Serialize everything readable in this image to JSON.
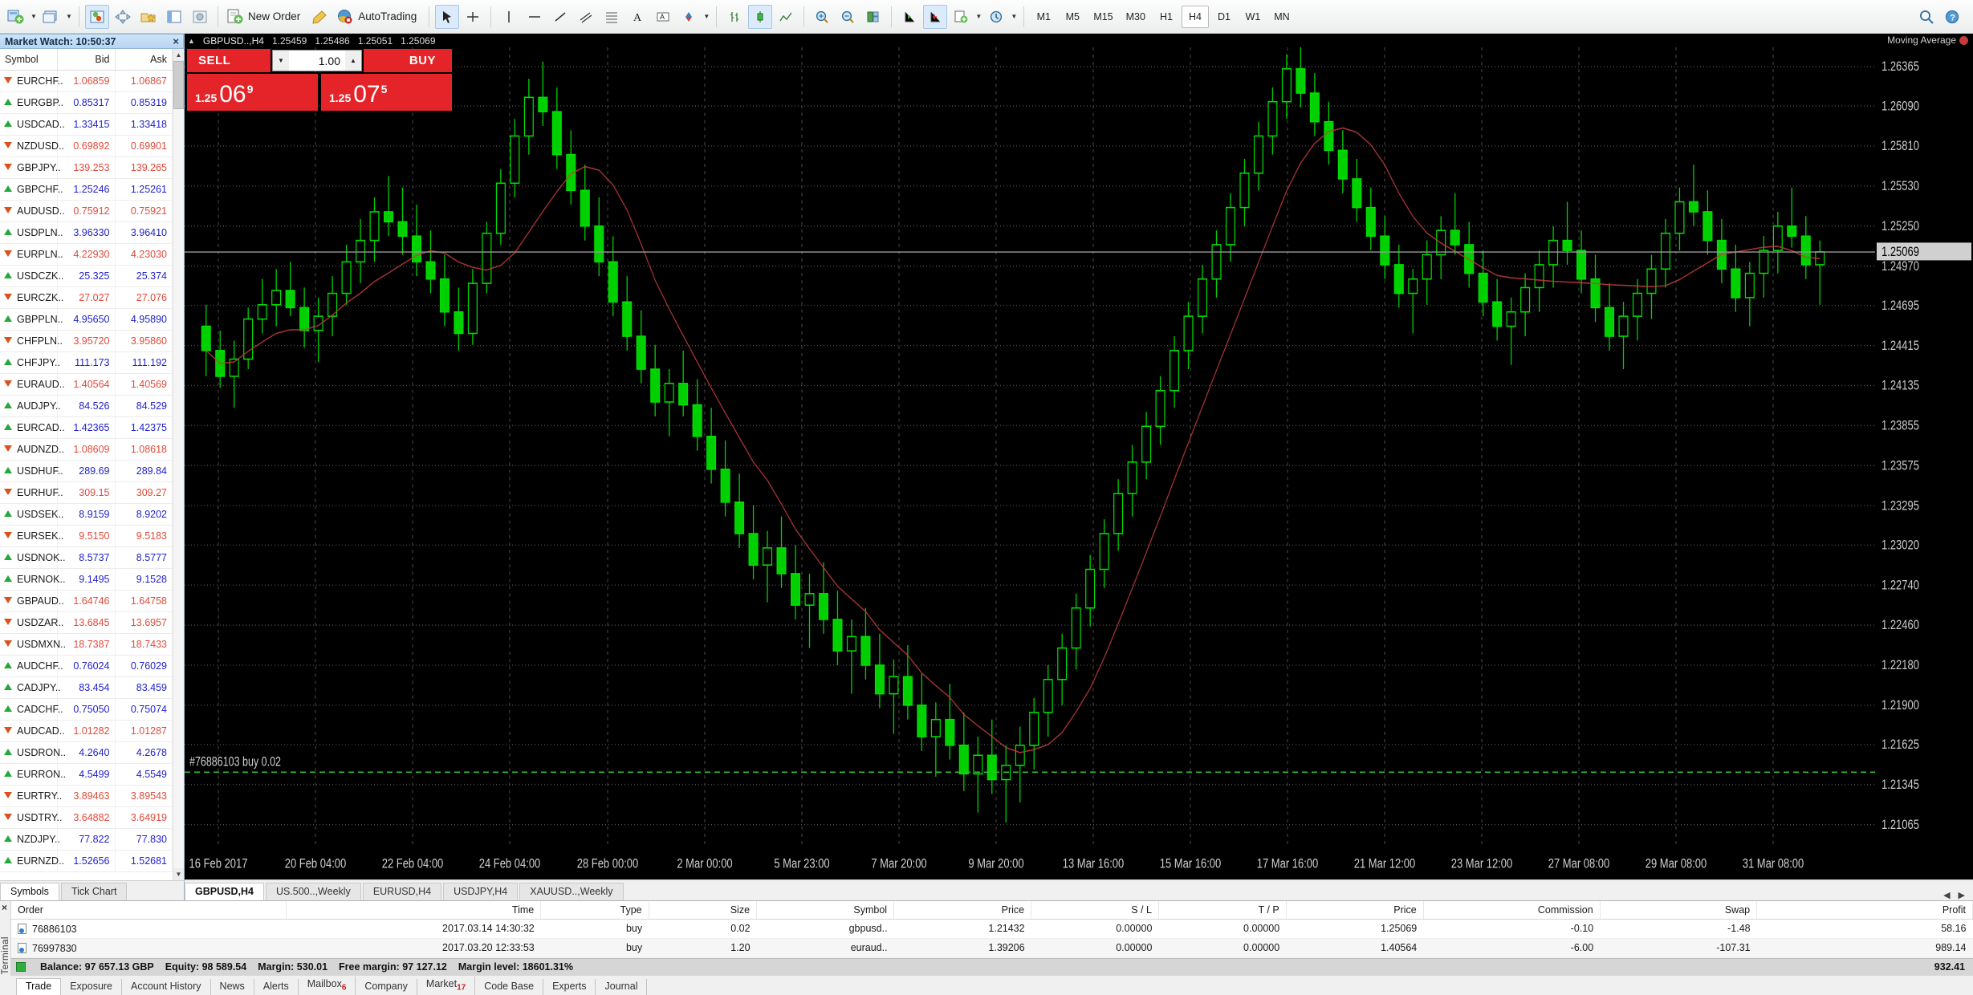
{
  "toolbar": {
    "new_order_label": "New Order",
    "autotrading_label": "AutoTrading",
    "timeframes": [
      {
        "label": "M1",
        "active": false
      },
      {
        "label": "M5",
        "active": false
      },
      {
        "label": "M15",
        "active": false
      },
      {
        "label": "M30",
        "active": false
      },
      {
        "label": "H1",
        "active": false
      },
      {
        "label": "H4",
        "active": true
      },
      {
        "label": "D1",
        "active": false
      },
      {
        "label": "W1",
        "active": false
      },
      {
        "label": "MN",
        "active": false
      }
    ]
  },
  "market_watch": {
    "title": "Market Watch: 10:50:37",
    "columns": [
      "Symbol",
      "Bid",
      "Ask"
    ],
    "rows": [
      {
        "symbol": "EURCHF..",
        "bid": "1.06859",
        "ask": "1.06867",
        "dir": "down"
      },
      {
        "symbol": "EURGBP..",
        "bid": "0.85317",
        "ask": "0.85319",
        "dir": "up"
      },
      {
        "symbol": "USDCAD..",
        "bid": "1.33415",
        "ask": "1.33418",
        "dir": "up"
      },
      {
        "symbol": "NZDUSD..",
        "bid": "0.69892",
        "ask": "0.69901",
        "dir": "down"
      },
      {
        "symbol": "GBPJPY..",
        "bid": "139.253",
        "ask": "139.265",
        "dir": "down"
      },
      {
        "symbol": "GBPCHF..",
        "bid": "1.25246",
        "ask": "1.25261",
        "dir": "up"
      },
      {
        "symbol": "AUDUSD..",
        "bid": "0.75912",
        "ask": "0.75921",
        "dir": "down"
      },
      {
        "symbol": "USDPLN..",
        "bid": "3.96330",
        "ask": "3.96410",
        "dir": "up"
      },
      {
        "symbol": "EURPLN..",
        "bid": "4.22930",
        "ask": "4.23030",
        "dir": "down"
      },
      {
        "symbol": "USDCZK..",
        "bid": "25.325",
        "ask": "25.374",
        "dir": "up"
      },
      {
        "symbol": "EURCZK..",
        "bid": "27.027",
        "ask": "27.076",
        "dir": "down"
      },
      {
        "symbol": "GBPPLN..",
        "bid": "4.95650",
        "ask": "4.95890",
        "dir": "up"
      },
      {
        "symbol": "CHFPLN..",
        "bid": "3.95720",
        "ask": "3.95860",
        "dir": "down"
      },
      {
        "symbol": "CHFJPY..",
        "bid": "111.173",
        "ask": "111.192",
        "dir": "up"
      },
      {
        "symbol": "EURAUD..",
        "bid": "1.40564",
        "ask": "1.40569",
        "dir": "down"
      },
      {
        "symbol": "AUDJPY..",
        "bid": "84.526",
        "ask": "84.529",
        "dir": "up"
      },
      {
        "symbol": "EURCAD..",
        "bid": "1.42365",
        "ask": "1.42375",
        "dir": "up"
      },
      {
        "symbol": "AUDNZD..",
        "bid": "1.08609",
        "ask": "1.08618",
        "dir": "down"
      },
      {
        "symbol": "USDHUF..",
        "bid": "289.69",
        "ask": "289.84",
        "dir": "up"
      },
      {
        "symbol": "EURHUF..",
        "bid": "309.15",
        "ask": "309.27",
        "dir": "down"
      },
      {
        "symbol": "USDSEK..",
        "bid": "8.9159",
        "ask": "8.9202",
        "dir": "up"
      },
      {
        "symbol": "EURSEK..",
        "bid": "9.5150",
        "ask": "9.5183",
        "dir": "down"
      },
      {
        "symbol": "USDNOK..",
        "bid": "8.5737",
        "ask": "8.5777",
        "dir": "up"
      },
      {
        "symbol": "EURNOK..",
        "bid": "9.1495",
        "ask": "9.1528",
        "dir": "up"
      },
      {
        "symbol": "GBPAUD..",
        "bid": "1.64746",
        "ask": "1.64758",
        "dir": "down"
      },
      {
        "symbol": "USDZAR..",
        "bid": "13.6845",
        "ask": "13.6957",
        "dir": "down"
      },
      {
        "symbol": "USDMXN..",
        "bid": "18.7387",
        "ask": "18.7433",
        "dir": "down"
      },
      {
        "symbol": "AUDCHF..",
        "bid": "0.76024",
        "ask": "0.76029",
        "dir": "up"
      },
      {
        "symbol": "CADJPY..",
        "bid": "83.454",
        "ask": "83.459",
        "dir": "up"
      },
      {
        "symbol": "CADCHF..",
        "bid": "0.75050",
        "ask": "0.75074",
        "dir": "up"
      },
      {
        "symbol": "AUDCAD..",
        "bid": "1.01282",
        "ask": "1.01287",
        "dir": "down"
      },
      {
        "symbol": "USDRON..",
        "bid": "4.2640",
        "ask": "4.2678",
        "dir": "up"
      },
      {
        "symbol": "EURRON..",
        "bid": "4.5499",
        "ask": "4.5549",
        "dir": "up"
      },
      {
        "symbol": "EURTRY..",
        "bid": "3.89463",
        "ask": "3.89543",
        "dir": "down"
      },
      {
        "symbol": "USDTRY..",
        "bid": "3.64882",
        "ask": "3.64919",
        "dir": "down"
      },
      {
        "symbol": "NZDJPY..",
        "bid": "77.822",
        "ask": "77.830",
        "dir": "up"
      },
      {
        "symbol": "EURNZD..",
        "bid": "1.52656",
        "ask": "1.52681",
        "dir": "up"
      }
    ],
    "tabs": [
      {
        "label": "Symbols",
        "active": true
      },
      {
        "label": "Tick Chart",
        "active": false
      }
    ]
  },
  "chart": {
    "header": {
      "symbol": "GBPUSD..,H4",
      "open": "1.25459",
      "high": "1.25486",
      "low": "1.25051",
      "close": "1.25069",
      "indicator": "Moving Average"
    },
    "one_click": {
      "sell_label": "SELL",
      "buy_label": "BUY",
      "volume": "1.00",
      "sell_price_prefix": "1.25",
      "sell_price_main": "06",
      "sell_price_sup": "9",
      "buy_price_prefix": "1.25",
      "buy_price_main": "07",
      "buy_price_sup": "5"
    },
    "position_label": "#76886103 buy 0.02",
    "price_axis": [
      "1.26365",
      "1.26090",
      "1.25810",
      "1.25530",
      "1.25250",
      "1.25069",
      "1.24970",
      "1.24695",
      "1.24415",
      "1.24135",
      "1.23855",
      "1.23575",
      "1.23295",
      "1.23020",
      "1.22740",
      "1.22460",
      "1.22180",
      "1.21900",
      "1.21625",
      "1.21345",
      "1.21065"
    ],
    "time_axis": [
      "16 Feb 2017",
      "20 Feb 04:00",
      "22 Feb 04:00",
      "24 Feb 04:00",
      "28 Feb 00:00",
      "2 Mar 00:00",
      "5 Mar 23:00",
      "7 Mar 20:00",
      "9 Mar 20:00",
      "13 Mar 16:00",
      "15 Mar 16:00",
      "17 Mar 16:00",
      "21 Mar 12:00",
      "23 Mar 12:00",
      "27 Mar 08:00",
      "29 Mar 08:00",
      "31 Mar 08:00"
    ],
    "tabs": [
      {
        "label": "GBPUSD,H4",
        "active": true
      },
      {
        "label": "US.500..,Weekly",
        "active": false
      },
      {
        "label": "EURUSD,H4",
        "active": false
      },
      {
        "label": "USDJPY,H4",
        "active": false
      },
      {
        "label": "XAUUSD..,Weekly",
        "active": false
      }
    ]
  },
  "terminal": {
    "side_label": "Terminal",
    "columns": [
      "Order",
      "Time",
      "Type",
      "Size",
      "Symbol",
      "Price",
      "S / L",
      "T / P",
      "Price",
      "Commission",
      "Swap",
      "Profit"
    ],
    "rows": [
      {
        "order": "76886103",
        "time": "2017.03.14 14:30:32",
        "type": "buy",
        "size": "0.02",
        "symbol": "gbpusd..",
        "price_open": "1.21432",
        "sl": "0.00000",
        "tp": "0.00000",
        "price_cur": "1.25069",
        "commission": "-0.10",
        "swap": "-1.48",
        "profit": "58.16"
      },
      {
        "order": "76997830",
        "time": "2017.03.20 12:33:53",
        "type": "buy",
        "size": "1.20",
        "symbol": "euraud..",
        "price_open": "1.39206",
        "sl": "0.00000",
        "tp": "0.00000",
        "price_cur": "1.40564",
        "commission": "-6.00",
        "swap": "-107.31",
        "profit": "989.14"
      }
    ],
    "balance": {
      "balance": "Balance: 97 657.13 GBP",
      "equity": "Equity: 98 589.54",
      "margin": "Margin: 530.01",
      "free_margin": "Free margin: 97 127.12",
      "margin_level": "Margin level: 18601.31%",
      "total_profit": "932.41"
    },
    "tabs": [
      {
        "label": "Trade",
        "active": true,
        "badge": ""
      },
      {
        "label": "Exposure",
        "active": false,
        "badge": ""
      },
      {
        "label": "Account History",
        "active": false,
        "badge": ""
      },
      {
        "label": "News",
        "active": false,
        "badge": ""
      },
      {
        "label": "Alerts",
        "active": false,
        "badge": ""
      },
      {
        "label": "Mailbox",
        "active": false,
        "badge": "6"
      },
      {
        "label": "Company",
        "active": false,
        "badge": ""
      },
      {
        "label": "Market",
        "active": false,
        "badge": "17"
      },
      {
        "label": "Code Base",
        "active": false,
        "badge": ""
      },
      {
        "label": "Experts",
        "active": false,
        "badge": ""
      },
      {
        "label": "Journal",
        "active": false,
        "badge": ""
      }
    ]
  },
  "chart_data": {
    "type": "candlestick",
    "title": "GBPUSD..,H4",
    "xlabel": "",
    "ylabel": "",
    "ylim": [
      1.209,
      1.265
    ],
    "grid": true,
    "legend": "Moving Average",
    "ticks_x": [
      "16 Feb 2017",
      "20 Feb 04:00",
      "22 Feb 04:00",
      "24 Feb 04:00",
      "28 Feb 00:00",
      "2 Mar 00:00",
      "5 Mar 23:00",
      "7 Mar 20:00",
      "9 Mar 20:00",
      "13 Mar 16:00",
      "15 Mar 16:00",
      "17 Mar 16:00",
      "21 Mar 12:00",
      "23 Mar 12:00",
      "27 Mar 08:00",
      "29 Mar 08:00",
      "31 Mar 08:00"
    ],
    "ticks_y": [
      "1.26365",
      "1.26090",
      "1.25810",
      "1.25530",
      "1.25250",
      "1.24970",
      "1.24695",
      "1.24415",
      "1.24135",
      "1.23855",
      "1.23575",
      "1.23295",
      "1.23020",
      "1.22740",
      "1.22460",
      "1.22180",
      "1.21900",
      "1.21625",
      "1.21345",
      "1.21065"
    ],
    "current_price": "1.25069",
    "position_line": 1.21432,
    "candles": [
      [
        1.2455,
        1.247,
        1.242,
        1.2438
      ],
      [
        1.2438,
        1.2452,
        1.2412,
        1.242
      ],
      [
        1.242,
        1.2445,
        1.2398,
        1.2432
      ],
      [
        1.2432,
        1.2468,
        1.2425,
        1.246
      ],
      [
        1.246,
        1.2488,
        1.245,
        1.247
      ],
      [
        1.247,
        1.2495,
        1.2455,
        1.248
      ],
      [
        1.248,
        1.25,
        1.2462,
        1.2468
      ],
      [
        1.2468,
        1.2482,
        1.244,
        1.2452
      ],
      [
        1.2452,
        1.2475,
        1.243,
        1.2462
      ],
      [
        1.2462,
        1.249,
        1.2448,
        1.2478
      ],
      [
        1.2478,
        1.2512,
        1.247,
        1.25
      ],
      [
        1.25,
        1.253,
        1.2485,
        1.2515
      ],
      [
        1.2515,
        1.2545,
        1.25,
        1.2535
      ],
      [
        1.2535,
        1.256,
        1.2518,
        1.2528
      ],
      [
        1.2528,
        1.2552,
        1.2505,
        1.2518
      ],
      [
        1.2518,
        1.254,
        1.249,
        1.25
      ],
      [
        1.25,
        1.2522,
        1.2478,
        1.2488
      ],
      [
        1.2488,
        1.2505,
        1.2455,
        1.2465
      ],
      [
        1.2465,
        1.2482,
        1.2438,
        1.245
      ],
      [
        1.245,
        1.2495,
        1.2442,
        1.2485
      ],
      [
        1.2485,
        1.2528,
        1.2478,
        1.252
      ],
      [
        1.252,
        1.2565,
        1.2512,
        1.2555
      ],
      [
        1.2555,
        1.26,
        1.2545,
        1.2588
      ],
      [
        1.2588,
        1.2628,
        1.2575,
        1.2615
      ],
      [
        1.2615,
        1.264,
        1.2595,
        1.2605
      ],
      [
        1.2605,
        1.2622,
        1.2565,
        1.2575
      ],
      [
        1.2575,
        1.2592,
        1.254,
        1.255
      ],
      [
        1.255,
        1.2568,
        1.2515,
        1.2525
      ],
      [
        1.2525,
        1.2545,
        1.249,
        1.25
      ],
      [
        1.25,
        1.2518,
        1.2462,
        1.2472
      ],
      [
        1.2472,
        1.249,
        1.2438,
        1.2448
      ],
      [
        1.2448,
        1.2466,
        1.2415,
        1.2425
      ],
      [
        1.2425,
        1.2442,
        1.2392,
        1.2402
      ],
      [
        1.2402,
        1.2425,
        1.2378,
        1.2415
      ],
      [
        1.2415,
        1.2438,
        1.2392,
        1.24
      ],
      [
        1.24,
        1.2418,
        1.2368,
        1.2378
      ],
      [
        1.2378,
        1.2398,
        1.2345,
        1.2355
      ],
      [
        1.2355,
        1.2375,
        1.2322,
        1.2332
      ],
      [
        1.2332,
        1.2352,
        1.23,
        1.231
      ],
      [
        1.231,
        1.233,
        1.2278,
        1.2288
      ],
      [
        1.2288,
        1.2312,
        1.2262,
        1.23
      ],
      [
        1.23,
        1.2322,
        1.2272,
        1.2282
      ],
      [
        1.2282,
        1.2302,
        1.225,
        1.226
      ],
      [
        1.226,
        1.2282,
        1.223,
        1.2268
      ],
      [
        1.2268,
        1.229,
        1.224,
        1.225
      ],
      [
        1.225,
        1.227,
        1.2218,
        1.2228
      ],
      [
        1.2228,
        1.225,
        1.2198,
        1.2238
      ],
      [
        1.2238,
        1.2258,
        1.2208,
        1.2218
      ],
      [
        1.2218,
        1.224,
        1.2188,
        1.2198
      ],
      [
        1.2198,
        1.2222,
        1.217,
        1.221
      ],
      [
        1.221,
        1.2232,
        1.218,
        1.219
      ],
      [
        1.219,
        1.2212,
        1.2158,
        1.2168
      ],
      [
        1.2168,
        1.2192,
        1.214,
        1.218
      ],
      [
        1.218,
        1.2205,
        1.2152,
        1.2162
      ],
      [
        1.2162,
        1.2185,
        1.213,
        1.2142
      ],
      [
        1.2142,
        1.2168,
        1.2115,
        1.2155
      ],
      [
        1.2155,
        1.218,
        1.2128,
        1.2138
      ],
      [
        1.2138,
        1.2162,
        1.2108,
        1.2148
      ],
      [
        1.2148,
        1.2175,
        1.2122,
        1.2162
      ],
      [
        1.2162,
        1.2195,
        1.2145,
        1.2185
      ],
      [
        1.2185,
        1.2218,
        1.2168,
        1.2208
      ],
      [
        1.2208,
        1.224,
        1.219,
        1.223
      ],
      [
        1.223,
        1.2268,
        1.2215,
        1.2258
      ],
      [
        1.2258,
        1.2295,
        1.2245,
        1.2285
      ],
      [
        1.2285,
        1.232,
        1.2272,
        1.231
      ],
      [
        1.231,
        1.2348,
        1.2298,
        1.2338
      ],
      [
        1.2338,
        1.2372,
        1.2322,
        1.236
      ],
      [
        1.236,
        1.2395,
        1.2348,
        1.2385
      ],
      [
        1.2385,
        1.242,
        1.2372,
        1.241
      ],
      [
        1.241,
        1.2448,
        1.2398,
        1.2438
      ],
      [
        1.2438,
        1.2472,
        1.2425,
        1.2462
      ],
      [
        1.2462,
        1.2498,
        1.245,
        1.2488
      ],
      [
        1.2488,
        1.2522,
        1.2475,
        1.2512
      ],
      [
        1.2512,
        1.2548,
        1.25,
        1.2538
      ],
      [
        1.2538,
        1.2572,
        1.2525,
        1.2562
      ],
      [
        1.2562,
        1.2598,
        1.255,
        1.2588
      ],
      [
        1.2588,
        1.2622,
        1.2575,
        1.2612
      ],
      [
        1.2612,
        1.2645,
        1.26,
        1.2635
      ],
      [
        1.2635,
        1.265,
        1.2608,
        1.2618
      ],
      [
        1.2618,
        1.2632,
        1.2588,
        1.2598
      ],
      [
        1.2598,
        1.2612,
        1.2568,
        1.2578
      ],
      [
        1.2578,
        1.2592,
        1.2548,
        1.2558
      ],
      [
        1.2558,
        1.2572,
        1.2528,
        1.2538
      ],
      [
        1.2538,
        1.2552,
        1.2508,
        1.2518
      ],
      [
        1.2518,
        1.2532,
        1.2488,
        1.2498
      ],
      [
        1.2498,
        1.2512,
        1.2468,
        1.2478
      ],
      [
        1.2478,
        1.2495,
        1.245,
        1.2488
      ],
      [
        1.2488,
        1.2515,
        1.247,
        1.2505
      ],
      [
        1.2505,
        1.2532,
        1.2488,
        1.2522
      ],
      [
        1.2522,
        1.2548,
        1.2505,
        1.2512
      ],
      [
        1.2512,
        1.2528,
        1.2482,
        1.2492
      ],
      [
        1.2492,
        1.2508,
        1.2462,
        1.2472
      ],
      [
        1.2472,
        1.2488,
        1.2445,
        1.2455
      ],
      [
        1.2455,
        1.2475,
        1.2428,
        1.2465
      ],
      [
        1.2465,
        1.2492,
        1.2448,
        1.2482
      ],
      [
        1.2482,
        1.2508,
        1.2465,
        1.2498
      ],
      [
        1.2498,
        1.2525,
        1.2482,
        1.2515
      ],
      [
        1.2515,
        1.2542,
        1.2498,
        1.2508
      ],
      [
        1.2508,
        1.2522,
        1.2478,
        1.2488
      ],
      [
        1.2488,
        1.2505,
        1.2458,
        1.2468
      ],
      [
        1.2468,
        1.2485,
        1.2438,
        1.2448
      ],
      [
        1.2448,
        1.2472,
        1.2425,
        1.2462
      ],
      [
        1.2462,
        1.2488,
        1.2445,
        1.2478
      ],
      [
        1.2478,
        1.2505,
        1.246,
        1.2495
      ],
      [
        1.2495,
        1.253,
        1.2482,
        1.252
      ],
      [
        1.252,
        1.2552,
        1.2508,
        1.2542
      ],
      [
        1.2542,
        1.2568,
        1.2525,
        1.2535
      ],
      [
        1.2535,
        1.255,
        1.2505,
        1.2515
      ],
      [
        1.2515,
        1.253,
        1.2485,
        1.2495
      ],
      [
        1.2495,
        1.2512,
        1.2465,
        1.2475
      ],
      [
        1.2475,
        1.25,
        1.2455,
        1.2492
      ],
      [
        1.2492,
        1.2518,
        1.2475,
        1.2508
      ],
      [
        1.2508,
        1.2535,
        1.2492,
        1.2525
      ],
      [
        1.2525,
        1.2552,
        1.251,
        1.2518
      ],
      [
        1.2518,
        1.2532,
        1.2488,
        1.2498
      ],
      [
        1.2498,
        1.2515,
        1.247,
        1.2507
      ]
    ]
  }
}
